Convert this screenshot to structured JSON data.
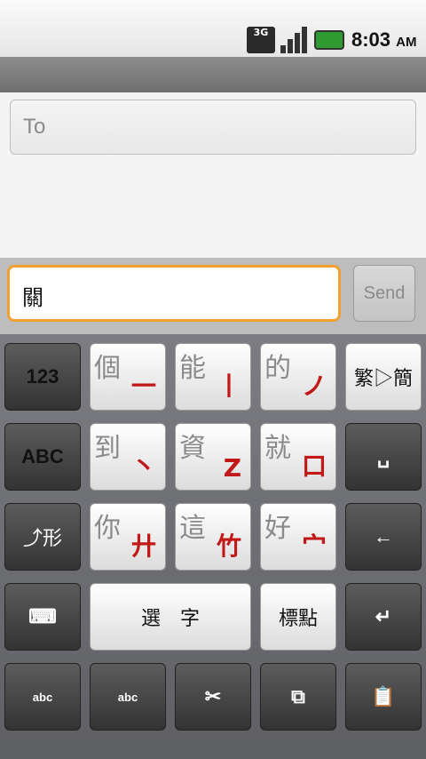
{
  "status": {
    "network": "3G",
    "time": "8:03",
    "ampm": "AM"
  },
  "compose": {
    "to_placeholder": "To",
    "message_value": "關",
    "send_label": "Send"
  },
  "keyboard": {
    "row1": [
      {
        "label": "123"
      },
      {
        "main": "個",
        "sub": "一"
      },
      {
        "main": "能",
        "sub": "丨"
      },
      {
        "main": "的",
        "sub": "ノ"
      },
      {
        "label": "繁▷簡"
      }
    ],
    "row2": [
      {
        "label": "ABC"
      },
      {
        "main": "到",
        "sub": "丶"
      },
      {
        "main": "資",
        "sub": "Z"
      },
      {
        "main": "就",
        "sub": "口"
      },
      {
        "label": "␣"
      }
    ],
    "row3": [
      {
        "label": "⤴形"
      },
      {
        "main": "你",
        "sub": "廾"
      },
      {
        "main": "這",
        "sub": "竹"
      },
      {
        "main": "好",
        "sub": "宀"
      },
      {
        "label": "←"
      }
    ],
    "row4": [
      {
        "label": "⌨"
      },
      {
        "label": "選　字"
      },
      {
        "label": "標點"
      },
      {
        "label": "↵"
      }
    ],
    "row5": [
      {
        "label": "abc"
      },
      {
        "label": "abc"
      },
      {
        "label": "✂"
      },
      {
        "label": "⧉"
      },
      {
        "label": "📋"
      }
    ]
  }
}
